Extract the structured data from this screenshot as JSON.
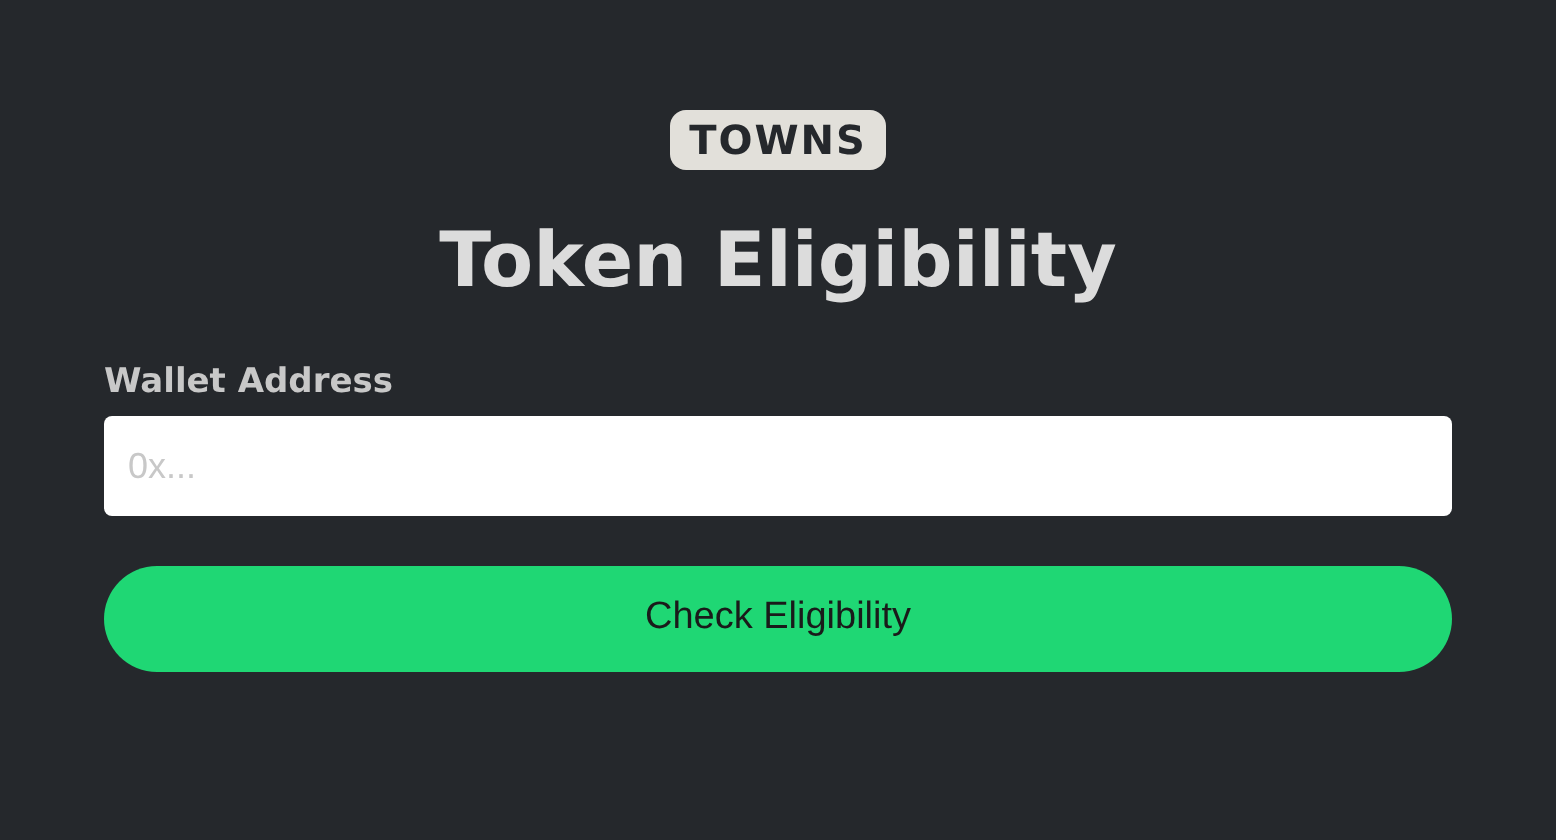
{
  "logo": {
    "text": "TOWNS"
  },
  "title": "Token Eligibility",
  "wallet_field": {
    "label": "Wallet Address",
    "placeholder": "0x..."
  },
  "button": {
    "label": "Check Eligibility"
  }
}
